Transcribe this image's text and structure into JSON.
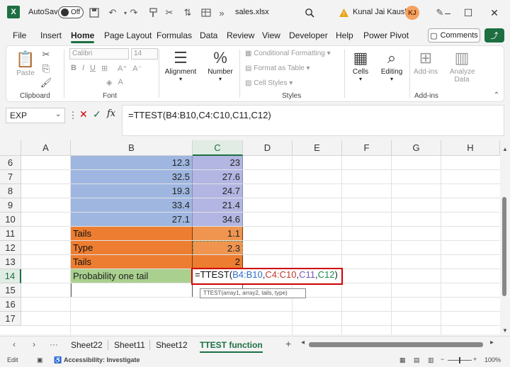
{
  "titlebar": {
    "autosave_label": "AutoSave",
    "autosave_state": "Off",
    "filename": "sales.xlsx",
    "user_name": "Kunal Jai Kaushik",
    "user_initials": "KJ"
  },
  "menu": {
    "tabs": [
      "File",
      "Insert",
      "Home",
      "Page Layout",
      "Formulas",
      "Data",
      "Review",
      "View",
      "Developer",
      "Help",
      "Power Pivot"
    ],
    "active": "Home",
    "comments_label": "Comments"
  },
  "ribbon": {
    "paste": "Paste",
    "clipboard": "Clipboard",
    "font_name": "Calibri",
    "font_size": "14",
    "font_group": "Font",
    "alignment": "Alignment",
    "number": "Number",
    "conditional_formatting": "Conditional Formatting",
    "format_as_table": "Format as Table",
    "cell_styles": "Cell Styles",
    "styles_group": "Styles",
    "cells": "Cells",
    "editing": "Editing",
    "addins": "Add-ins",
    "addins_group": "Add-ins",
    "analyze_data": "Analyze Data"
  },
  "formula_bar": {
    "name_box": "EXP",
    "formula": "=TTEST(B4:B10,C4:C10,C11,C12)"
  },
  "grid": {
    "columns": [
      "A",
      "B",
      "C",
      "D",
      "E",
      "F",
      "G",
      "H"
    ],
    "rows": [
      {
        "num": "6",
        "b": "12.3",
        "c": "23"
      },
      {
        "num": "7",
        "b": "32.5",
        "c": "27.6"
      },
      {
        "num": "8",
        "b": "19.3",
        "c": "24.7"
      },
      {
        "num": "9",
        "b": "33.4",
        "c": "21.4"
      },
      {
        "num": "10",
        "b": "27.1",
        "c": "34.6"
      },
      {
        "num": "11",
        "b": "Tails",
        "c": "1.1"
      },
      {
        "num": "12",
        "b": "Type",
        "c": "2.3"
      },
      {
        "num": "13",
        "b": "Tails",
        "c": "2"
      },
      {
        "num": "14",
        "b": "Probability one tail",
        "c": ""
      },
      {
        "num": "15",
        "b": "",
        "c": ""
      },
      {
        "num": "16",
        "b": "",
        "c": ""
      },
      {
        "num": "17",
        "b": "",
        "c": ""
      }
    ],
    "edit": {
      "prefix": "=TTEST(",
      "ref1": "B4:B10",
      "ref2": "C4:C10",
      "ref3": "C11",
      "ref4": "C12",
      "suffix": ")",
      "comma": ","
    },
    "tooltip": "TTEST(array1, array2, tails, type)"
  },
  "sheets": {
    "tabs": [
      "Sheet22",
      "Sheet11",
      "Sheet12",
      "TTEST function"
    ],
    "active": "TTEST function",
    "more": "···"
  },
  "status": {
    "mode": "Edit",
    "accessibility": "Accessibility: Investigate",
    "zoom": "100%"
  }
}
